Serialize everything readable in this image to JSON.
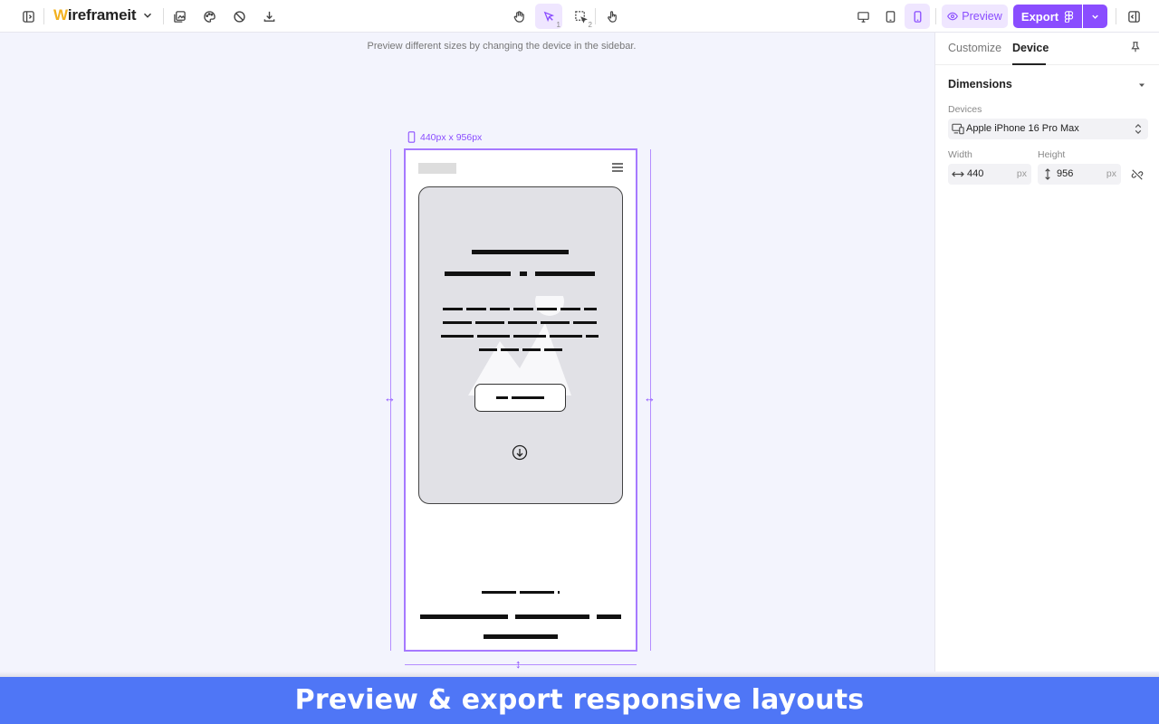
{
  "app": {
    "name_first_letter": "W",
    "name_rest": "ireframeit"
  },
  "toolbar": {
    "select_tool_shortcut": "1",
    "marquee_tool_shortcut": "2",
    "preview_label": "Preview",
    "export_label": "Export"
  },
  "canvas": {
    "hint": "Preview different sizes by changing the device in the sidebar.",
    "frame_dimensions": "440px x 956px"
  },
  "panel": {
    "tabs": [
      {
        "label": "Customize",
        "active": false
      },
      {
        "label": "Device",
        "active": true
      }
    ],
    "section_title": "Dimensions",
    "devices_label": "Devices",
    "device_selected": "Apple iPhone 16 Pro Max",
    "width_label": "Width",
    "width_value": "440",
    "width_unit": "px",
    "height_label": "Height",
    "height_value": "956",
    "height_unit": "px"
  },
  "caption": "Preview & export responsive layouts",
  "colors": {
    "accent": "#8a4dff",
    "caption_bg": "#4f76f6"
  }
}
